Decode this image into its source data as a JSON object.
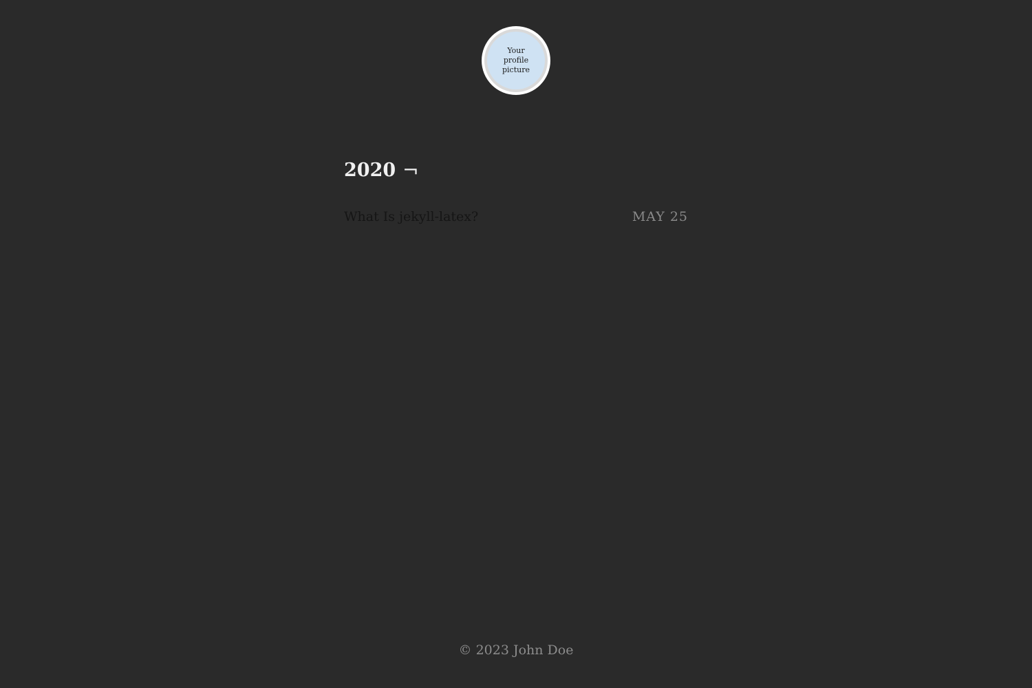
{
  "header": {
    "avatar_text": "Your profile picture"
  },
  "archive": {
    "year": "2020",
    "year_symbol": "¬",
    "posts": [
      {
        "title": "What Is jekyll-latex?",
        "date": "MAY 25"
      }
    ]
  },
  "footer": {
    "copyright": "© 2023 John Doe"
  },
  "colors": {
    "background": "#2a2a2a",
    "heading": "#f0f0f0",
    "post_link": "#151515",
    "date": "#8a8a8a",
    "avatar_bg": "#cfe2f3"
  }
}
